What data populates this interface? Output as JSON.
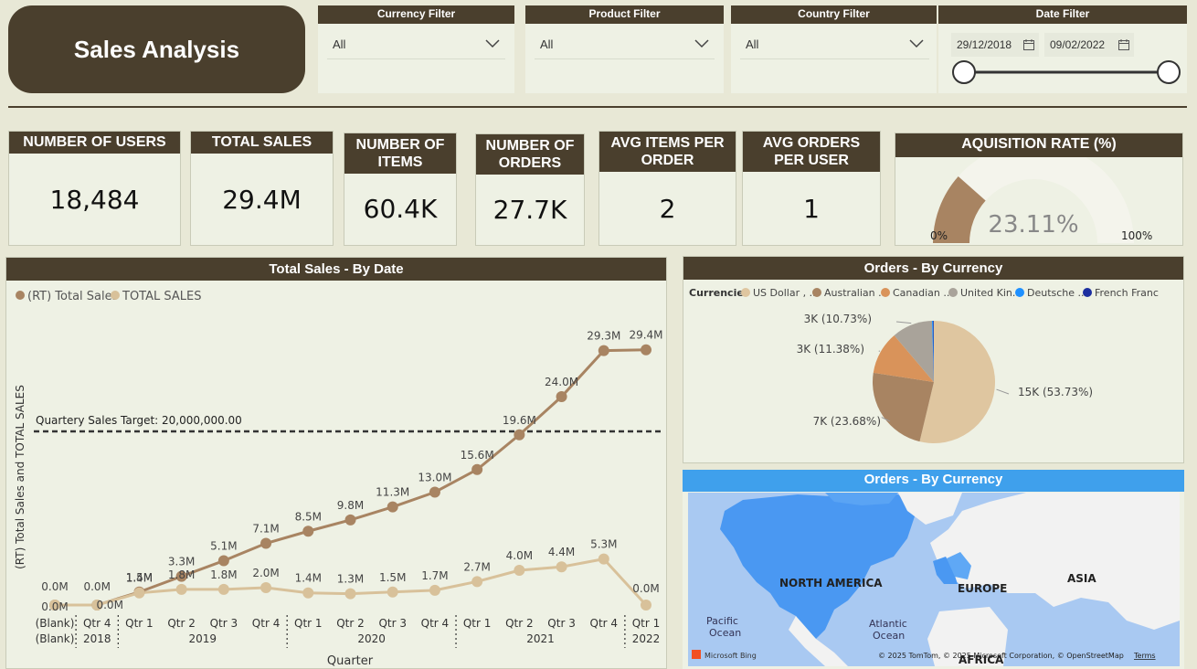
{
  "title": "Sales Analysis",
  "filters": {
    "currency": {
      "label": "Currency Filter",
      "value": "All"
    },
    "product": {
      "label": "Product Filter",
      "value": "All"
    },
    "country": {
      "label": "Country Filter",
      "value": "All"
    },
    "date": {
      "label": "Date Filter",
      "start": "29/12/2018",
      "end": "09/02/2022",
      "range": [
        0,
        1
      ]
    }
  },
  "kpis": [
    {
      "label": "NUMBER OF USERS",
      "value": "18,484"
    },
    {
      "label": "TOTAL SALES",
      "value": "29.4M"
    },
    {
      "label": "NUMBER OF ITEMS",
      "value": "60.4K"
    },
    {
      "label": "NUMBER OF ORDERS",
      "value": "27.7K"
    },
    {
      "label": "AVG ITEMS PER ORDER",
      "value": "2"
    },
    {
      "label": "AVG ORDERS PER USER",
      "value": "1"
    }
  ],
  "gauge": {
    "label": "AQUISITION RATE (%)",
    "value": "23.11%",
    "fraction": 0.2311,
    "min_label": "0%",
    "max_label": "100%"
  },
  "colors": {
    "dark": "#4a3f2d",
    "rt": "#a88462",
    "total": "#d8c19a",
    "background": "#e8e8d6",
    "panel": "#eef1e4"
  },
  "chart_data": [
    {
      "type": "line",
      "title": "Total Sales - By Date",
      "xlabel": "Quarter",
      "ylabel": "(RT) Total Sales and TOTAL SALES",
      "categories": [
        "(Blank)",
        "Qtr 4",
        "Qtr 1",
        "Qtr 2",
        "Qtr 3",
        "Qtr 4",
        "Qtr 1",
        "Qtr 2",
        "Qtr 3",
        "Qtr 4",
        "Qtr 1",
        "Qtr 2",
        "Qtr 3",
        "Qtr 4",
        "Qtr 1"
      ],
      "year_groups": [
        {
          "label": "(Blank)",
          "from": 0,
          "to": 0
        },
        {
          "label": "2018",
          "from": 1,
          "to": 1
        },
        {
          "label": "2019",
          "from": 2,
          "to": 5
        },
        {
          "label": "2020",
          "from": 6,
          "to": 9
        },
        {
          "label": "2021",
          "from": 10,
          "to": 13
        },
        {
          "label": "2022",
          "from": 14,
          "to": 14
        }
      ],
      "series": [
        {
          "name": "(RT) Total Sales",
          "values": [
            0,
            0,
            1.5,
            3.3,
            5.1,
            7.1,
            8.5,
            9.8,
            11.3,
            13.0,
            15.6,
            19.6,
            24.0,
            29.3,
            29.4
          ],
          "labels": [
            "0.0M",
            "0.0M",
            "1.5M",
            "3.3M",
            "5.1M",
            "7.1M",
            "8.5M",
            "9.8M",
            "11.3M",
            "13.0M",
            "15.6M",
            "19.6M",
            "24.0M",
            "29.3M",
            "29.4M"
          ]
        },
        {
          "name": "TOTAL SALES",
          "values": [
            0,
            0,
            1.4,
            1.8,
            1.8,
            2.0,
            1.4,
            1.3,
            1.5,
            1.7,
            2.7,
            4.0,
            4.4,
            5.3,
            0
          ],
          "labels": [
            "0.0M",
            "0.0M",
            "1.4M",
            "1.8M",
            "1.8M",
            "2.0M",
            "1.4M",
            "1.3M",
            "1.5M",
            "1.7M",
            "2.7M",
            "4.0M",
            "4.4M",
            "5.3M",
            "0.0M"
          ]
        }
      ],
      "reference_line": {
        "label": "Quartery Sales Target: 20,000,000.00",
        "value": 20
      },
      "ylim": [
        0,
        30
      ],
      "legend": "top-left",
      "grid": false
    },
    {
      "type": "pie",
      "title": "Orders - By Currency",
      "legend_title": "Currencies",
      "legend": [
        "US Dollar , ...",
        "Australian ...",
        "Canadian ...",
        "United Kin...",
        "Deutsche ...",
        "French Franc"
      ],
      "slices": [
        {
          "name": "US Dollar",
          "value": 53.73,
          "label": "15K (53.73%)",
          "color": "#dfc6a0"
        },
        {
          "name": "Australian Dollar",
          "value": 23.68,
          "label": "7K (23.68%)",
          "color": "#a88462"
        },
        {
          "name": "Canadian Dollar",
          "value": 11.38,
          "label": "3K (11.38%)",
          "color": "#d9935a"
        },
        {
          "name": "United Kingdom Pound",
          "value": 10.73,
          "label": "3K (10.73%)",
          "color": "#a9a39a"
        },
        {
          "name": "Deutsche Mark",
          "value": 0.3,
          "label": "",
          "color": "#1e90ff"
        },
        {
          "name": "French Franc",
          "value": 0.18,
          "label": "",
          "color": "#1c2fa0"
        }
      ],
      "legend_placement": "top"
    }
  ],
  "map": {
    "title": "Orders - By Currency",
    "labels": {
      "north_america": "NORTH AMERICA",
      "europe": "EUROPE",
      "asia": "ASIA",
      "africa": "AFRICA",
      "pacific": "Pacific\nOcean",
      "atlantic": "Atlantic\nOcean"
    },
    "attribution": "© 2025 TomTom, © 2025 Microsoft Corporation, © OpenStreetMap",
    "terms": "Terms",
    "logo": "Microsoft Bing"
  }
}
